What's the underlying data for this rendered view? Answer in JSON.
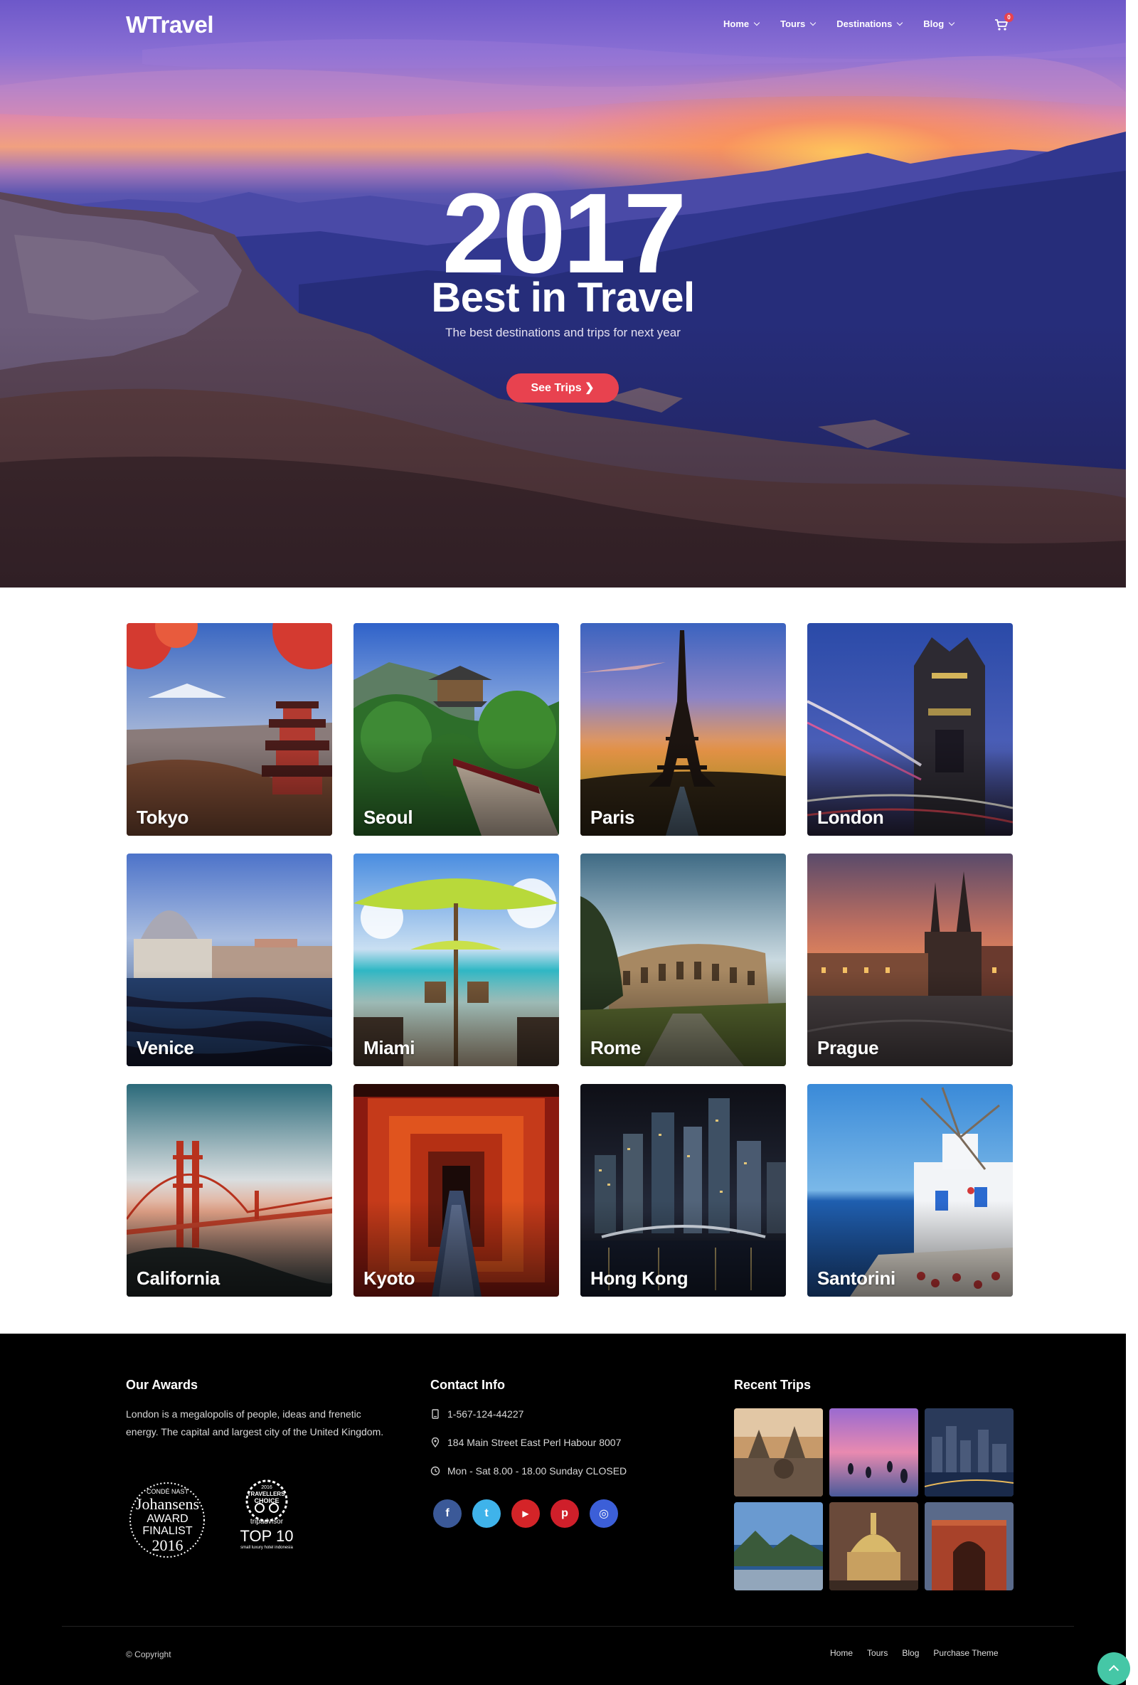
{
  "header": {
    "logo": "WTravel",
    "nav": [
      {
        "label": "Home"
      },
      {
        "label": "Tours"
      },
      {
        "label": "Destinations"
      },
      {
        "label": "Blog"
      }
    ],
    "cart_count": "0"
  },
  "hero": {
    "year": "2017",
    "title": "Best in Travel",
    "subtitle": "The best destinations and trips for next year",
    "button": "See Trips"
  },
  "destinations": [
    {
      "name": "Tokyo"
    },
    {
      "name": "Seoul"
    },
    {
      "name": "Paris"
    },
    {
      "name": "London"
    },
    {
      "name": "Venice"
    },
    {
      "name": "Miami"
    },
    {
      "name": "Rome"
    },
    {
      "name": "Prague"
    },
    {
      "name": "California"
    },
    {
      "name": "Kyoto"
    },
    {
      "name": "Hong Kong"
    },
    {
      "name": "Santorini"
    }
  ],
  "footer": {
    "awards": {
      "title": "Our Awards",
      "text": "London is a megalopolis of people, ideas and frenetic energy. The capital and largest city of the United Kingdom.",
      "badge1": {
        "line1": "CONDÉ NAST",
        "line2": "Johansens",
        "line3": "AWARD",
        "line4": "FINALIST",
        "line5": "2016"
      },
      "badge2": {
        "line1": "2016",
        "line2": "TRAVELLERS'",
        "line3": "CHOICE",
        "line4": "tripadvisor",
        "line5": "TOP 10",
        "line6": "small luxury hotel indonesia"
      }
    },
    "contact": {
      "title": "Contact Info",
      "phone": "1-567-124-44227",
      "address": "184 Main Street East Perl Habour 8007",
      "hours": "Mon - Sat 8.00 - 18.00 Sunday CLOSED"
    },
    "socials": [
      {
        "name": "facebook",
        "glyph": "f",
        "color": "#3b5998"
      },
      {
        "name": "twitter",
        "glyph": "t",
        "color": "#3fb3ea"
      },
      {
        "name": "youtube",
        "glyph": "▶",
        "color": "#d42428"
      },
      {
        "name": "pinterest",
        "glyph": "p",
        "color": "#cf1f2a"
      },
      {
        "name": "instagram",
        "glyph": "◎",
        "color": "#3c5fd8"
      }
    ],
    "recent": {
      "title": "Recent Trips"
    },
    "copyright": "© Copyright",
    "links": [
      {
        "label": "Home"
      },
      {
        "label": "Tours"
      },
      {
        "label": "Blog"
      },
      {
        "label": "Purchase Theme"
      }
    ]
  },
  "colors": {
    "accent": "#e8424f",
    "to_top": "#45c7a6",
    "footer_bg": "#000000"
  }
}
